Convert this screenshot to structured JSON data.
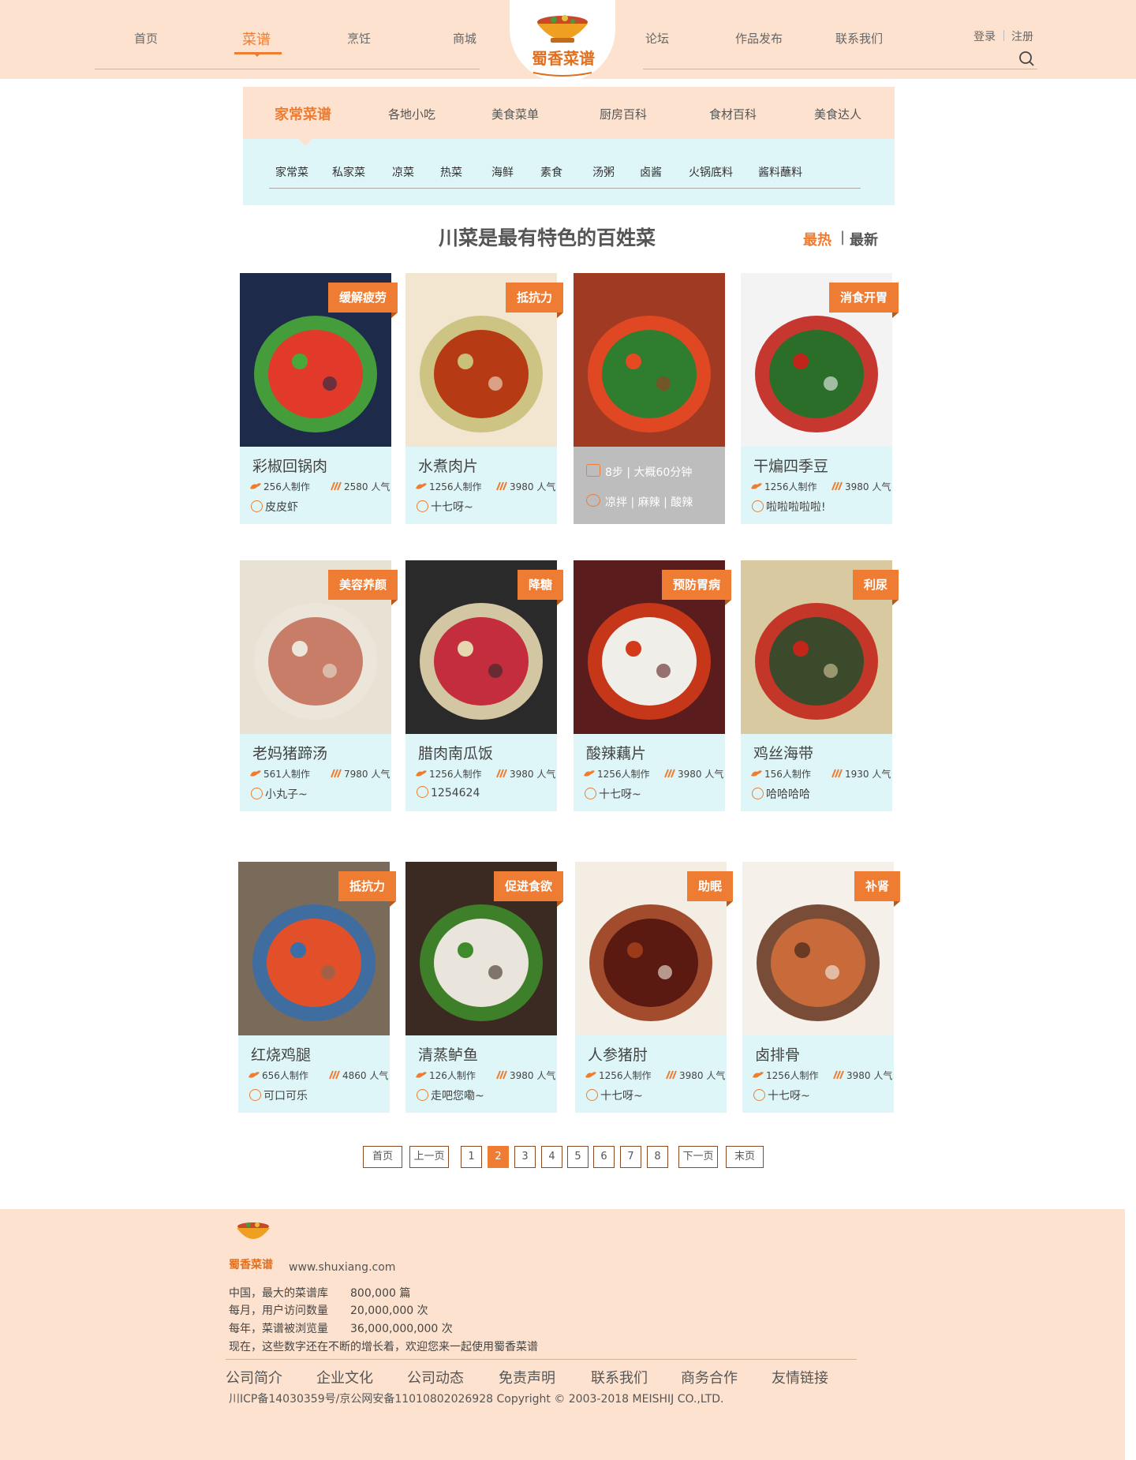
{
  "header": {
    "nav_left": [
      "首页",
      "菜谱",
      "烹饪",
      "商城"
    ],
    "nav_right": [
      "论坛",
      "作品发布",
      "联系我们"
    ],
    "logo_text": "蜀香菜谱",
    "login": "登录",
    "register": "注册"
  },
  "categories": {
    "tabs": [
      "家常菜谱",
      "各地小吃",
      "美食菜单",
      "厨房百科",
      "食材百科",
      "美食达人"
    ],
    "sub": [
      "家常菜",
      "私家菜",
      "凉菜",
      "热菜",
      "海鲜",
      "素食",
      "汤粥",
      "卤酱",
      "火锅底料",
      "酱料蘸料"
    ]
  },
  "section": {
    "title": "川菜是最有特色的百姓菜",
    "sort_hot": "最热",
    "sort_sep": "|",
    "sort_new": "最新"
  },
  "recipes": [
    {
      "name": "彩椒回锅肉",
      "tag": "缓解疲劳",
      "made": "256人制作",
      "popularity": "2580 人气",
      "author": "皮皮虾"
    },
    {
      "name": "水煮肉片",
      "tag": "抵抗力",
      "made": "1256人制作",
      "popularity": "3980 人气",
      "author": "十七呀~"
    },
    {
      "name": "",
      "tag": "",
      "hover_steps": "8步 | 大概60分钟",
      "hover_tags": "凉拌 | 麻辣 | 酸辣"
    },
    {
      "name": "干煸四季豆",
      "tag": "消食开胃",
      "made": "1256人制作",
      "popularity": "3980 人气",
      "author": "啦啦啦啦啦!"
    },
    {
      "name": "老妈猪蹄汤",
      "tag": "美容养颜",
      "made": "561人制作",
      "popularity": "7980 人气",
      "author": "小丸子~"
    },
    {
      "name": "腊肉南瓜饭",
      "tag": "降糖",
      "made": "1256人制作",
      "popularity": "3980 人气",
      "author": "1254624"
    },
    {
      "name": "酸辣藕片",
      "tag": "预防胃病",
      "made": "1256人制作",
      "popularity": "3980 人气",
      "author": "十七呀~"
    },
    {
      "name": "鸡丝海带",
      "tag": "利尿",
      "made": "156人制作",
      "popularity": "1930 人气",
      "author": "哈哈哈哈"
    },
    {
      "name": "红烧鸡腿",
      "tag": "抵抗力",
      "made": "656人制作",
      "popularity": "4860 人气",
      "author": "可口可乐"
    },
    {
      "name": "清蒸鲈鱼",
      "tag": "促进食欲",
      "made": "126人制作",
      "popularity": "3980 人气",
      "author": "走吧您嘞~"
    },
    {
      "name": "人参猪肘",
      "tag": "助眠",
      "made": "1256人制作",
      "popularity": "3980 人气",
      "author": "十七呀~"
    },
    {
      "name": "卤排骨",
      "tag": "补肾",
      "made": "1256人制作",
      "popularity": "3980 人气",
      "author": "十七呀~"
    }
  ],
  "pagination": {
    "first": "首页",
    "prev": "上一页",
    "pages": [
      "1",
      "2",
      "3",
      "4",
      "5",
      "6",
      "7",
      "8"
    ],
    "current": "2",
    "next": "下一页",
    "last": "末页"
  },
  "footer": {
    "logo_text": "蜀香菜谱",
    "url": "www.shuxiang.com",
    "stats": [
      {
        "label": "中国，最大的菜谱库",
        "value": "800,000 篇"
      },
      {
        "label": "每月，用户访问数量",
        "value": "20,000,000 次"
      },
      {
        "label": "每年，菜谱被浏览量",
        "value": "36,000,000,000 次"
      }
    ],
    "note": "现在，这些数字还在不断的增长着，欢迎您来一起使用蜀香菜谱",
    "links": [
      "公司简介",
      "企业文化",
      "公司动态",
      "免责声明",
      "联系我们",
      "商务合作",
      "友情链接"
    ],
    "copyright": "川ICP备14030359号/京公网安备11010802026928 Copyright © 2003-2018 MEISHIJ CO.,LTD."
  },
  "colors": {
    "accent": "#ee7d33",
    "header_bg": "#fde3cf",
    "card_bg": "#dff6f8"
  }
}
